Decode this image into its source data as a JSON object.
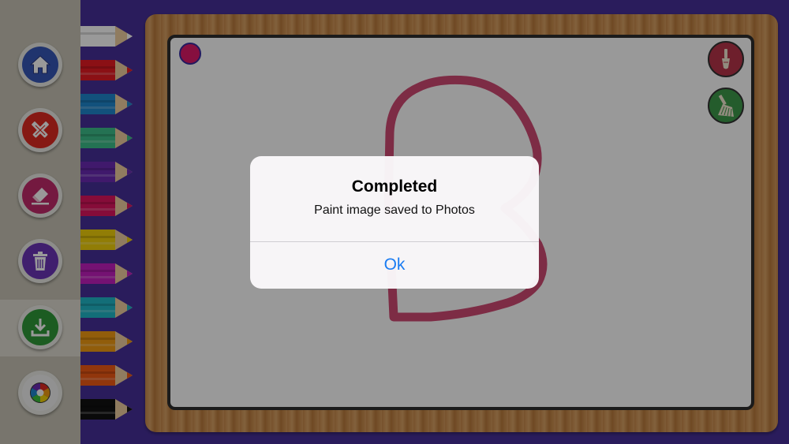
{
  "sidebar": {
    "buttons": [
      {
        "name": "home",
        "icon": "home-icon",
        "color": "#3657b8"
      },
      {
        "name": "pencils",
        "icon": "crossed-pencils-icon",
        "color": "#e02a22"
      },
      {
        "name": "eraser",
        "icon": "eraser-icon",
        "color": "#c12a6c"
      },
      {
        "name": "clear",
        "icon": "trash-icon",
        "color": "#6b35b8"
      },
      {
        "name": "save",
        "icon": "download-icon",
        "color": "#2f9a3a"
      },
      {
        "name": "colors",
        "icon": "color-wheel-icon",
        "color": "#f2f2f2"
      }
    ]
  },
  "pencils": [
    "#ffffff",
    "#e81c24",
    "#1e88cf",
    "#3dbf8a",
    "#6b2bb5",
    "#e0155f",
    "#f2d10b",
    "#c41fc0",
    "#21b8c8",
    "#f29c13",
    "#f25a15",
    "#111111"
  ],
  "board": {
    "selected_color": "#e01a6a",
    "stroke_color": "#d14a73",
    "tools": [
      {
        "name": "brush",
        "icon": "brush-icon",
        "color": "#b8344a"
      },
      {
        "name": "broom",
        "icon": "broom-icon",
        "color": "#3d9a4a"
      }
    ]
  },
  "alert": {
    "title": "Completed",
    "message": "Paint image saved to Photos",
    "ok_label": "Ok"
  }
}
